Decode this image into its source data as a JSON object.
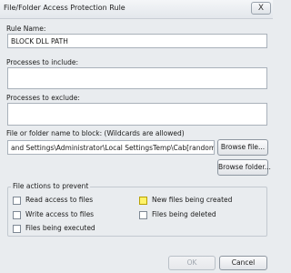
{
  "window": {
    "title": "File/Folder Access Protection Rule",
    "close_glyph": "X"
  },
  "rule_name": {
    "label": "Rule Name:",
    "value": "BLOCK DLL PATH"
  },
  "include": {
    "label": "Processes to include:",
    "value": ""
  },
  "exclude": {
    "label": "Processes to exclude:",
    "value": ""
  },
  "block": {
    "label": "File or folder name to block: (Wildcards are allowed)",
    "value": "and Settings\\Administrator\\Local SettingsTemp\\Cab[random.hex].tmp",
    "browse_file": "Browse file...",
    "browse_folder": "Browse folder..."
  },
  "actions": {
    "legend": "File actions to prevent",
    "read": "Read access to files",
    "write": "Write access to files",
    "executed": "Files being executed",
    "created": "New files being created",
    "deleted": "Files being deleted"
  },
  "footer": {
    "ok": "OK",
    "cancel": "Cancel"
  },
  "colors": {
    "highlight": "#fff36a",
    "window_bg": "#e9ecef"
  }
}
